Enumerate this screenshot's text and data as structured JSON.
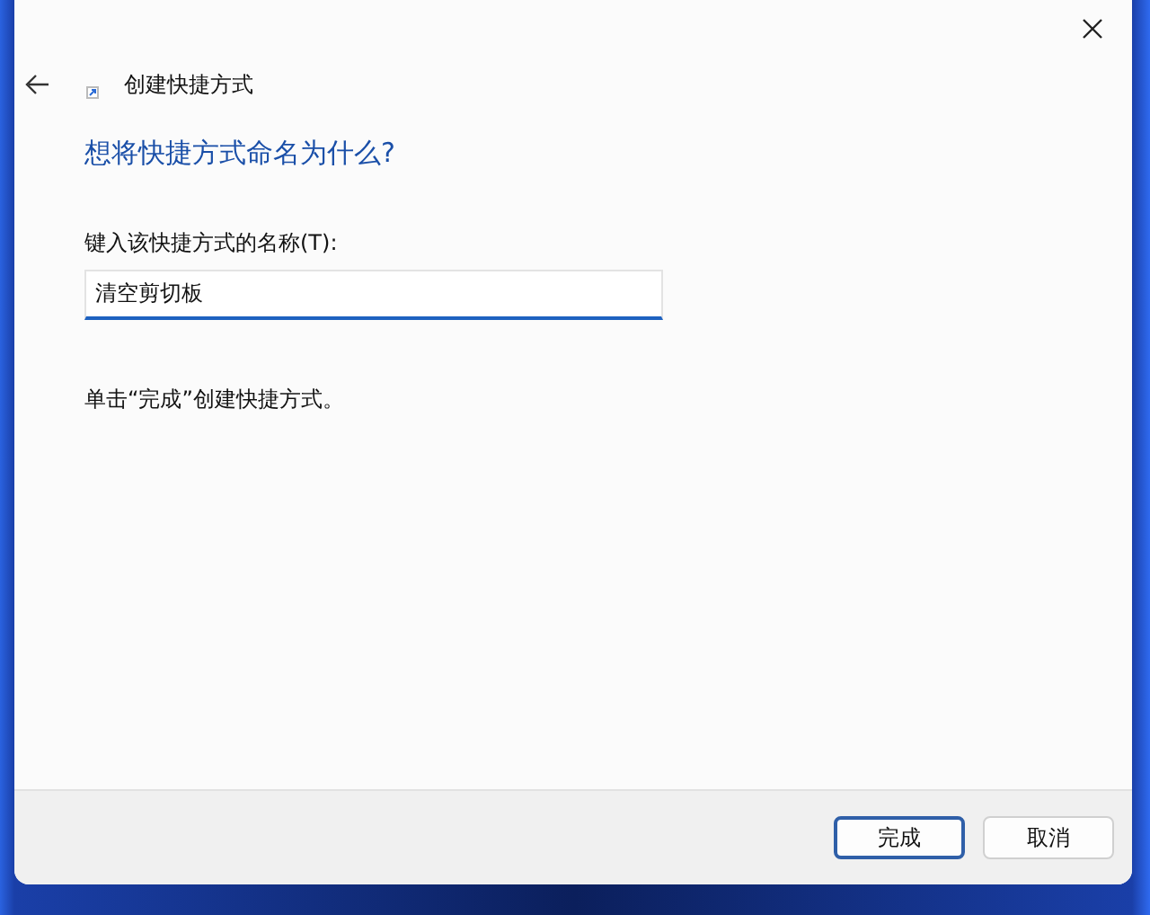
{
  "header": {
    "title": "创建快捷方式"
  },
  "heading": "想将快捷方式命名为什么?",
  "name_field": {
    "label": "键入该快捷方式的名称(T):",
    "value": "清空剪切板"
  },
  "instruction": "单击“完成”创建快捷方式。",
  "buttons": [
    {
      "label": "完成",
      "default": true
    },
    {
      "label": "取消",
      "default": false
    }
  ]
}
